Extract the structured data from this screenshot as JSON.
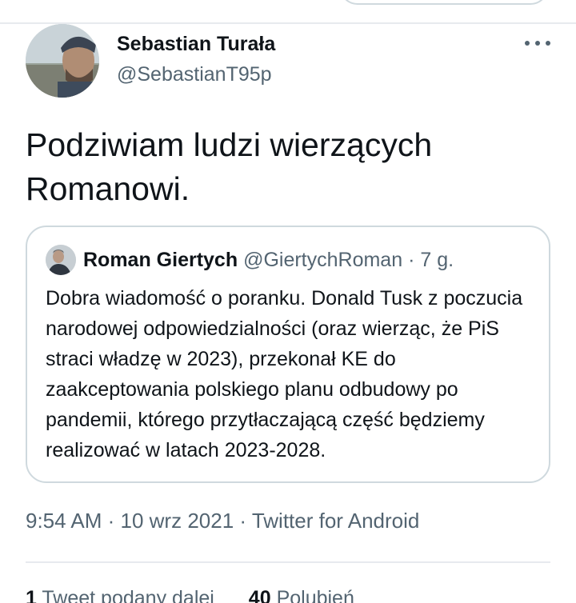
{
  "author": {
    "display_name": "Sebastian Turała",
    "handle": "@SebastianT95p"
  },
  "tweet": {
    "text": "Podziwiam ludzi wierzących Romanowi."
  },
  "quoted_tweet": {
    "display_name": "Roman Giertych",
    "handle": "@GiertychRoman",
    "separator": " · ",
    "time": "7 g.",
    "text": "Dobra wiadomość o poranku. Donald Tusk z poczucia narodowej odpowiedzialności (oraz wierząc, że PiS straci władzę w 2023), przekonał KE do zaakceptowania polskiego planu odbudowy po pandemii, którego przytłaczającą część będziemy realizować w latach 2023-2028."
  },
  "meta": {
    "time": "9:54 AM",
    "date": "10 wrz 2021",
    "source": "Twitter for Android",
    "separator": " · "
  },
  "stats": {
    "retweets_count": "1",
    "retweets_label": "Tweet podany dalej",
    "likes_count": "40",
    "likes_label": "Polubień"
  },
  "icons": {
    "more": "more-horizontal-icon"
  },
  "colors": {
    "text_primary": "#0f1419",
    "text_secondary": "#536471",
    "border": "#cfd9de"
  }
}
